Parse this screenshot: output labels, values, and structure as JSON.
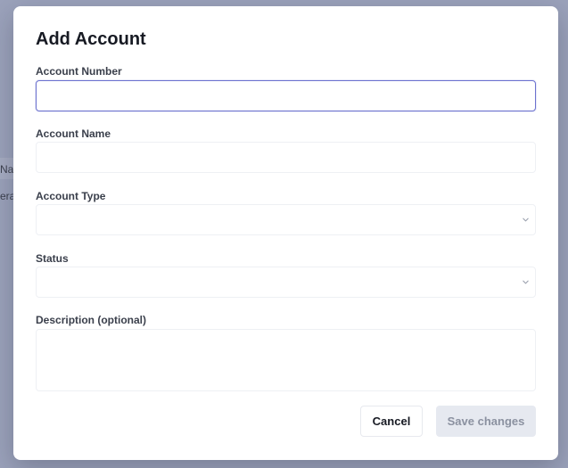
{
  "background": {
    "fragment_1": "Nar",
    "fragment_2": "era"
  },
  "dialog": {
    "title": "Add Account",
    "fields": {
      "account_number": {
        "label": "Account Number",
        "value": ""
      },
      "account_name": {
        "label": "Account Name",
        "value": ""
      },
      "account_type": {
        "label": "Account Type",
        "selected": ""
      },
      "status": {
        "label": "Status",
        "selected": ""
      },
      "description": {
        "label": "Description (optional)",
        "value": ""
      }
    },
    "buttons": {
      "cancel_label": "Cancel",
      "save_label": "Save changes"
    }
  },
  "colors": {
    "backdrop": "#9ba2bb",
    "focus_border": "#6c72cf",
    "disabled_button_bg": "#e6e9f0",
    "disabled_button_text": "#8b91a0"
  },
  "icons": {
    "select_chevron": "chevron-down-icon"
  }
}
